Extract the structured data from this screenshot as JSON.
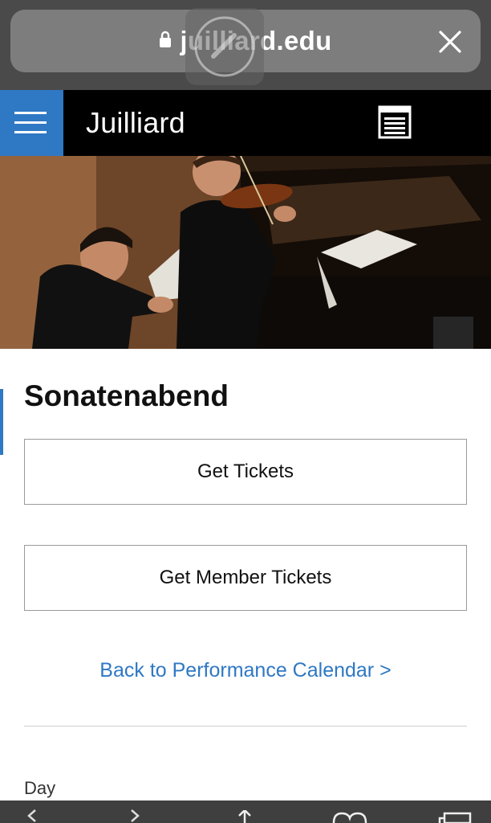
{
  "browser": {
    "url_display": "juilliard.edu",
    "icons": [
      "lock-icon",
      "close-icon",
      "reload-icon"
    ]
  },
  "header": {
    "logo": "Juilliard",
    "icons": [
      "hamburger-menu-icon",
      "calendar-icon"
    ],
    "accent_color": "#2f78c4"
  },
  "hero": {
    "image": "photo-violinist-and-pianist-performing"
  },
  "event": {
    "title": "Sonatenabend",
    "get_tickets_label": "Get Tickets",
    "get_member_tickets_label": "Get Member Tickets",
    "back_link_label": "Back to Performance Calendar >",
    "day_label": "Day"
  },
  "toolbar": {
    "icons": [
      "back-icon",
      "forward-icon",
      "share-icon",
      "bookmarks-icon",
      "tabs-icon"
    ]
  }
}
